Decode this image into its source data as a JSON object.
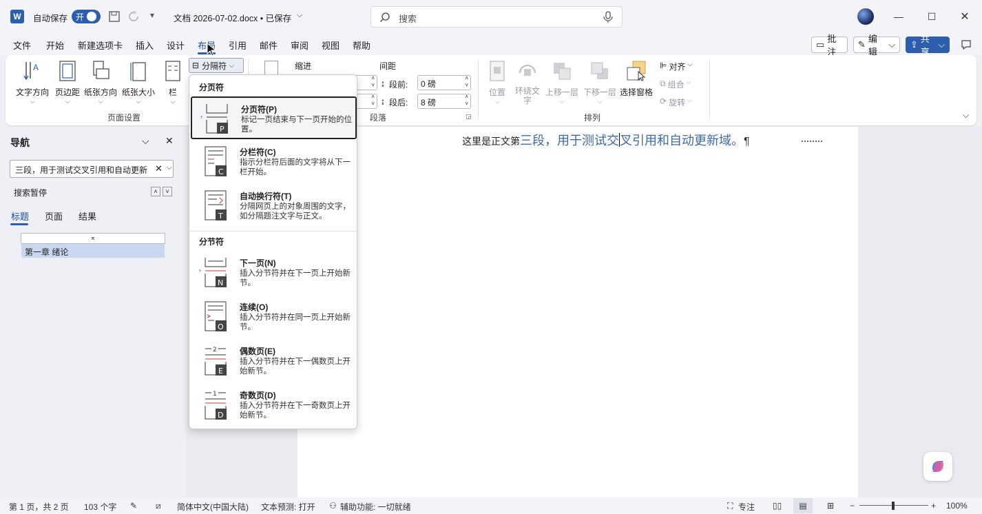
{
  "titlebar": {
    "autosave_label": "自动保存",
    "autosave_state": "开",
    "doc_title": "文档 2026-07-02.docx • 已保存",
    "search_placeholder": "搜索"
  },
  "menus": [
    "文件",
    "开始",
    "新建选项卡",
    "插入",
    "设计",
    "布局",
    "引用",
    "邮件",
    "审阅",
    "视图",
    "帮助"
  ],
  "active_menu": "布局",
  "top_buttons": {
    "comment": "批注",
    "edit": "编辑",
    "share": "共享"
  },
  "ribbon": {
    "page_setup": {
      "text_direction": "文字方向",
      "margins": "页边距",
      "orientation": "纸张方向",
      "size": "纸张大小",
      "columns": "栏",
      "breaks": "分隔符",
      "group_label": "页面设置"
    },
    "paragraph": {
      "indent_label": "缩进",
      "spacing_label": "间距",
      "before_label": "段前:",
      "before_value": "0 磅",
      "after_label": "段后:",
      "after_value": "8 磅",
      "group_label": "段落"
    },
    "arrange": {
      "position": "位置",
      "wrap_text": "环绕文字",
      "bring_forward": "上移一层",
      "send_backward": "下移一层",
      "selection_pane": "选择窗格",
      "align": "对齐",
      "group": "组合",
      "rotate": "旋转",
      "group_label": "排列"
    }
  },
  "dropdown": {
    "page_breaks_header": "分页符",
    "section_breaks_header": "分节符",
    "items": [
      {
        "title": "分页符(P)",
        "desc": "标记一页结束与下一页开始的位置。",
        "letter": "P"
      },
      {
        "title": "分栏符(C)",
        "desc": "指示分栏符后面的文字将从下一栏开始。",
        "letter": "C"
      },
      {
        "title": "自动换行符(T)",
        "desc": "分隔网页上的对象周围的文字，如分隔题注文字与正文。",
        "letter": "T"
      },
      {
        "title": "下一页(N)",
        "desc": "插入分节符并在下一页上开始新节。",
        "letter": "N"
      },
      {
        "title": "连续(O)",
        "desc": "插入分节符并在同一页上开始新节。",
        "letter": "O"
      },
      {
        "title": "偶数页(E)",
        "desc": "插入分节符并在下一偶数页上开始新节。",
        "letter": "E"
      },
      {
        "title": "奇数页(D)",
        "desc": "插入分节符并在下一奇数页上开始新节。",
        "letter": "D"
      }
    ]
  },
  "nav": {
    "title": "导航",
    "search_value": "三段，用于测试交叉引用和自动更新",
    "search_paused": "搜索暂停",
    "tabs": [
      "标题",
      "页面",
      "结果"
    ],
    "heading_item": "第一章 绪论"
  },
  "document": {
    "prefix": "这里是正文第",
    "highlight_before_cursor": "三段，用于测试交",
    "highlight_after_cursor": "叉引用和自动更新域。",
    "pilcrow": "¶"
  },
  "statusbar": {
    "page": "第 1 页，共 2 页",
    "words": "103 个字",
    "language": "简体中文(中国大陆)",
    "prediction": "文本预测: 打开",
    "accessibility": "辅助功能: 一切就绪",
    "focus": "专注",
    "zoom": "100%"
  },
  "colors": {
    "accent": "#2b5fad",
    "field_text": "#3d6aa6",
    "nav_highlight": "#c9d8f0"
  }
}
